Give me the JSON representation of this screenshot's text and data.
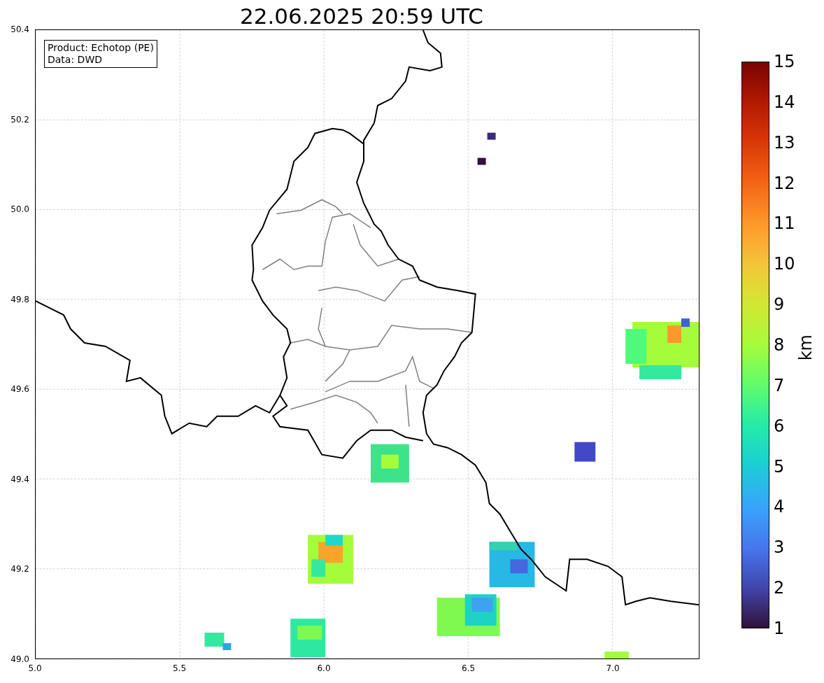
{
  "title": "22.06.2025 20:59 UTC",
  "info_box": [
    "Product: Echotop (PE)",
    "Data: DWD"
  ],
  "x_axis": {
    "ticks": [
      "5.0",
      "5.5",
      "6.0",
      "6.5",
      "7.0"
    ]
  },
  "y_axis": {
    "ticks": [
      "50.4",
      "50.2",
      "50.0",
      "49.8",
      "49.6",
      "49.4",
      "49.2",
      "49.0"
    ]
  },
  "colorbar": {
    "label": "km",
    "ticks": [
      "15",
      "14",
      "13",
      "12",
      "11",
      "10",
      "9",
      "8",
      "7",
      "6",
      "5",
      "4",
      "3",
      "2",
      "1"
    ]
  }
}
